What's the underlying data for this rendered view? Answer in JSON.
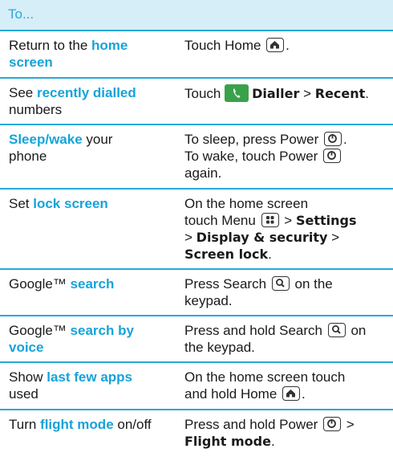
{
  "header": {
    "label": "To..."
  },
  "icons": {
    "home": "home-icon",
    "power": "power-icon",
    "menu": "menu-icon",
    "search": "search-icon",
    "dialler": "phone-icon"
  },
  "colors": {
    "accent": "#28a9d9",
    "header_bg": "#d6eef7",
    "dialler_green": "#3aa14a"
  },
  "rows": [
    {
      "left": {
        "pre": "Return to the ",
        "hl": "home screen",
        "post": ""
      },
      "right": {
        "t1": "Touch Home ",
        "t2": "."
      }
    },
    {
      "left": {
        "pre": "See ",
        "hl": "recently dialled",
        "post": " numbers"
      },
      "right": {
        "t1": "Touch ",
        "b1": "Dialler",
        "t2": " > ",
        "b2": "Recent",
        "t3": "."
      }
    },
    {
      "left": {
        "pre": "",
        "hl": "Sleep/wake",
        "post": " your phone"
      },
      "right": {
        "t1": "To sleep, press Power ",
        "t2": ".",
        "t3": "To wake, touch Power ",
        "t4": "again."
      }
    },
    {
      "left": {
        "pre": "Set ",
        "hl": "lock screen",
        "post": ""
      },
      "right": {
        "t1": "On the home screen",
        "t2": "touch Menu ",
        "t3": " > ",
        "b1": "Settings",
        "t4": "> ",
        "b2": "Display & security",
        "t5": " >",
        "b3": "Screen lock",
        "t6": "."
      }
    },
    {
      "left": {
        "pre": "Google™ ",
        "hl": "search",
        "post": ""
      },
      "right": {
        "t1": "Press Search ",
        "t2": " on the",
        "t3": "keypad."
      }
    },
    {
      "left": {
        "pre": "Google™ ",
        "hl": "search by voice",
        "post": ""
      },
      "right": {
        "t1": "Press and hold Search ",
        "t2": " on",
        "t3": "the keypad."
      }
    },
    {
      "left": {
        "pre": "Show ",
        "hl": "last few apps",
        "post": " used"
      },
      "right": {
        "t1": "On the home screen touch",
        "t2": "and hold Home ",
        "t3": "."
      }
    },
    {
      "left": {
        "pre": "Turn ",
        "hl": "flight mode",
        "post": " on/off"
      },
      "right": {
        "t1": "Press and hold Power ",
        "t2": " >",
        "b1": "Flight mode",
        "t3": "."
      }
    }
  ]
}
